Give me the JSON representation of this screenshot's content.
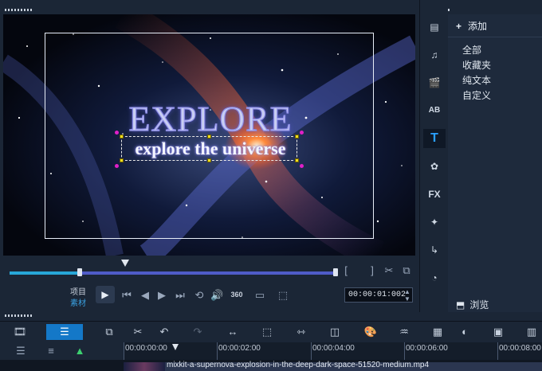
{
  "overlay": {
    "title": "EXPLORE",
    "subtitle": "explore the universe"
  },
  "controls": {
    "mode_project": "项目",
    "mode_clip": "素材",
    "timecode": "00:00:01:002",
    "badge_360": "360"
  },
  "tabs": [
    {
      "name": "media-tab-icon"
    },
    {
      "name": "audio-tab-icon"
    },
    {
      "name": "instant-project-tab-icon"
    },
    {
      "name": "transition-tab-icon",
      "label": "AB"
    },
    {
      "name": "title-tab-icon",
      "label": "T"
    },
    {
      "name": "graphics-tab-icon"
    },
    {
      "name": "filter-tab-icon",
      "label": "FX"
    },
    {
      "name": "effect-tab-icon"
    },
    {
      "name": "path-tab-icon"
    },
    {
      "name": "speed-tab-icon"
    }
  ],
  "library": {
    "add_label": "添加",
    "categories": [
      "全部",
      "收藏夹",
      "纯文本",
      "自定义"
    ],
    "browse_label": "浏览"
  },
  "timeline": {
    "ruler": [
      "00:00:00:00",
      "00:00:02:00",
      "00:00:04:00",
      "00:00:06:00",
      "00:00:08:00"
    ],
    "clip_name": "mixkit-a-supernova-explosion-in-the-deep-dark-space-51520-medium.mp4"
  },
  "colors": {
    "accent": "#1478c8",
    "title_tab": "#2aa0ff",
    "scrub_played": "#27a7d8",
    "scrub_range": "#4f5cc8"
  }
}
